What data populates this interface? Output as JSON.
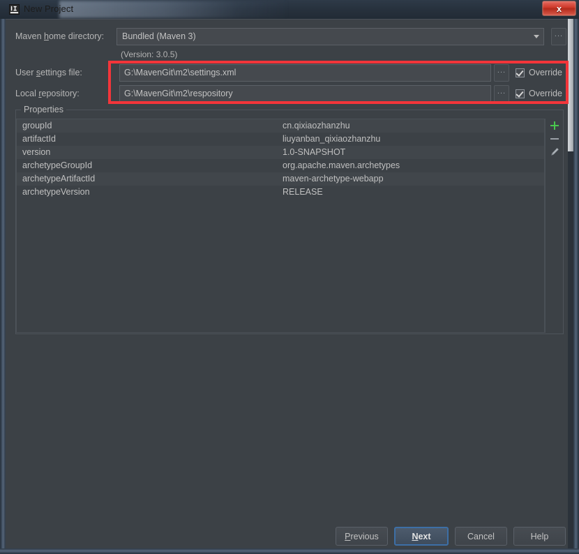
{
  "window": {
    "title": "New Project",
    "app_icon": "intellij-idea-icon",
    "close_label": "x",
    "accent_red": "#f3353a",
    "accent_blue": "#3d6fa6",
    "accent_green": "#49c74e"
  },
  "form": {
    "maven_home": {
      "label_pre": "Maven ",
      "label_mnemonic": "h",
      "label_post": "ome directory:",
      "value": "Bundled (Maven 3)",
      "browse_label": "...",
      "dropdown_icon": "chevron-down-icon"
    },
    "version_note": "(Version: 3.0.5)",
    "user_settings": {
      "label_pre": "User ",
      "label_mnemonic": "s",
      "label_post": "ettings file:",
      "value": "G:\\MavenGit\\m2\\settings.xml",
      "browse_label": "...",
      "override_label": "Override",
      "override_checked": true
    },
    "local_repository": {
      "label_pre": "Local ",
      "label_mnemonic": "r",
      "label_post": "epository:",
      "value": "G:\\MavenGit\\m2\\respository",
      "browse_label": "...",
      "override_label": "Override",
      "override_checked": true
    }
  },
  "properties": {
    "group_title": "Properties",
    "rows": [
      {
        "key": "groupId",
        "value": "cn.qixiaozhanzhu"
      },
      {
        "key": "artifactId",
        "value": "liuyanban_qixiaozhanzhu"
      },
      {
        "key": "version",
        "value": "1.0-SNAPSHOT"
      },
      {
        "key": "archetypeGroupId",
        "value": "org.apache.maven.archetypes"
      },
      {
        "key": "archetypeArtifactId",
        "value": "maven-archetype-webapp"
      },
      {
        "key": "archetypeVersion",
        "value": "RELEASE"
      }
    ],
    "toolbar": {
      "add_icon": "plus-icon",
      "remove_icon": "minus-icon",
      "edit_icon": "pencil-icon"
    }
  },
  "buttons": {
    "previous": {
      "pre": "",
      "mnemonic": "P",
      "post": "revious"
    },
    "next": {
      "pre": "",
      "mnemonic": "N",
      "post": "ext"
    },
    "cancel": {
      "label": "Cancel"
    },
    "help": {
      "label": "Help"
    }
  }
}
